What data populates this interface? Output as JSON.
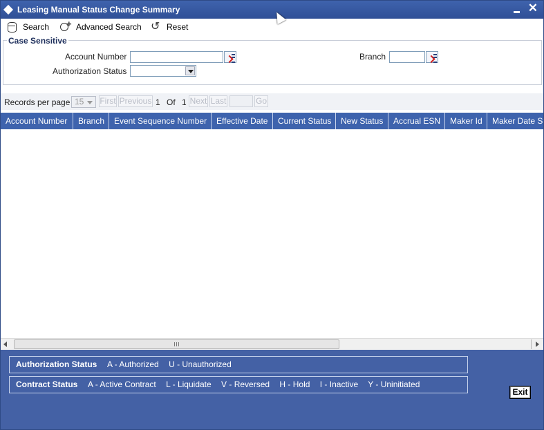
{
  "window": {
    "title": "Leasing Manual Status Change Summary",
    "minimize_glyph": "–",
    "close_glyph": "✕"
  },
  "toolbar": {
    "search_label": "Search",
    "advanced_search_label": "Advanced Search",
    "reset_label": "Reset"
  },
  "criteria": {
    "group_title": "Case Sensitive",
    "account_number_label": "Account Number",
    "account_number_value": "",
    "branch_label": "Branch",
    "branch_value": "",
    "auth_status_label": "Authorization Status",
    "auth_status_value": ""
  },
  "pager": {
    "records_per_page_label": "Records per page",
    "records_per_page_value": "15",
    "first_label": "First",
    "previous_label": "Previous",
    "current_page": "1",
    "of_label": "Of",
    "total_pages": "1",
    "next_label": "Next",
    "last_label": "Last",
    "go_label": "Go",
    "goto_value": ""
  },
  "grid": {
    "columns": [
      "Account Number",
      "Branch",
      "Event Sequence Number",
      "Effective Date",
      "Current Status",
      "New Status",
      "Accrual ESN",
      "Maker Id",
      "Maker Date Stamp"
    ],
    "rows": []
  },
  "legend": {
    "auth": {
      "title": "Authorization Status",
      "items": [
        "A - Authorized",
        "U - Unauthorized"
      ]
    },
    "contract": {
      "title": "Contract Status",
      "items": [
        "A - Active Contract",
        "L - Liquidate",
        "V - Reversed",
        "H - Hold",
        "I - Inactive",
        "Y - Uninitiated"
      ]
    }
  },
  "footer": {
    "exit_label": "Exit"
  },
  "colors": {
    "title_bar": "#3f63ad",
    "grid_header": "#3e63ad",
    "footer_bg": "#4461a5"
  },
  "icons": {
    "window": "diamond-icon",
    "search": "database-icon",
    "advanced_search": "advanced-search-icon",
    "reset": "reset-icon",
    "lov": "lov-icon"
  }
}
